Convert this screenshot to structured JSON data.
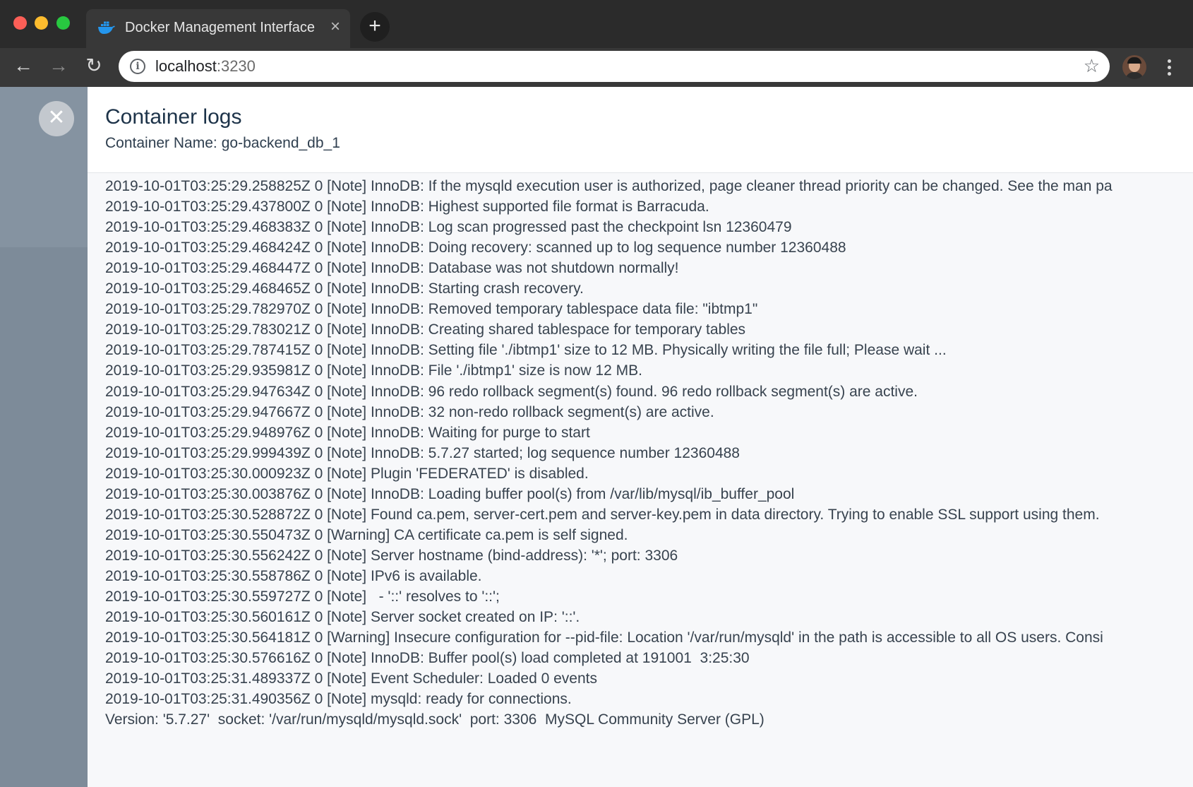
{
  "browser": {
    "tab_title": "Docker Management Interface",
    "url_host": "localhost",
    "url_port": ":3230"
  },
  "panel": {
    "title": "Container logs",
    "container_label": "Container Name:",
    "container_name": "go-backend_db_1"
  },
  "logs": [
    "2019-10-01T03:25:29.258825Z 0 [Note] InnoDB: If the mysqld execution user is authorized, page cleaner thread priority can be changed. See the man pa",
    "2019-10-01T03:25:29.437800Z 0 [Note] InnoDB: Highest supported file format is Barracuda.",
    "2019-10-01T03:25:29.468383Z 0 [Note] InnoDB: Log scan progressed past the checkpoint lsn 12360479",
    "2019-10-01T03:25:29.468424Z 0 [Note] InnoDB: Doing recovery: scanned up to log sequence number 12360488",
    "2019-10-01T03:25:29.468447Z 0 [Note] InnoDB: Database was not shutdown normally!",
    "2019-10-01T03:25:29.468465Z 0 [Note] InnoDB: Starting crash recovery.",
    "2019-10-01T03:25:29.782970Z 0 [Note] InnoDB: Removed temporary tablespace data file: \"ibtmp1\"",
    "2019-10-01T03:25:29.783021Z 0 [Note] InnoDB: Creating shared tablespace for temporary tables",
    "2019-10-01T03:25:29.787415Z 0 [Note] InnoDB: Setting file './ibtmp1' size to 12 MB. Physically writing the file full; Please wait ...",
    "2019-10-01T03:25:29.935981Z 0 [Note] InnoDB: File './ibtmp1' size is now 12 MB.",
    "2019-10-01T03:25:29.947634Z 0 [Note] InnoDB: 96 redo rollback segment(s) found. 96 redo rollback segment(s) are active.",
    "2019-10-01T03:25:29.947667Z 0 [Note] InnoDB: 32 non-redo rollback segment(s) are active.",
    "2019-10-01T03:25:29.948976Z 0 [Note] InnoDB: Waiting for purge to start",
    "2019-10-01T03:25:29.999439Z 0 [Note] InnoDB: 5.7.27 started; log sequence number 12360488",
    "2019-10-01T03:25:30.000923Z 0 [Note] Plugin 'FEDERATED' is disabled.",
    "2019-10-01T03:25:30.003876Z 0 [Note] InnoDB: Loading buffer pool(s) from /var/lib/mysql/ib_buffer_pool",
    "2019-10-01T03:25:30.528872Z 0 [Note] Found ca.pem, server-cert.pem and server-key.pem in data directory. Trying to enable SSL support using them.",
    "2019-10-01T03:25:30.550473Z 0 [Warning] CA certificate ca.pem is self signed.",
    "2019-10-01T03:25:30.556242Z 0 [Note] Server hostname (bind-address): '*'; port: 3306",
    "2019-10-01T03:25:30.558786Z 0 [Note] IPv6 is available.",
    "2019-10-01T03:25:30.559727Z 0 [Note]   - '::' resolves to '::';",
    "2019-10-01T03:25:30.560161Z 0 [Note] Server socket created on IP: '::'.",
    "2019-10-01T03:25:30.564181Z 0 [Warning] Insecure configuration for --pid-file: Location '/var/run/mysqld' in the path is accessible to all OS users. Consi",
    "2019-10-01T03:25:30.576616Z 0 [Note] InnoDB: Buffer pool(s) load completed at 191001  3:25:30",
    "2019-10-01T03:25:31.489337Z 0 [Note] Event Scheduler: Loaded 0 events",
    "2019-10-01T03:25:31.490356Z 0 [Note] mysqld: ready for connections.",
    "Version: '5.7.27'  socket: '/var/run/mysqld/mysqld.sock'  port: 3306  MySQL Community Server (GPL)"
  ],
  "icons": {
    "tab_favicon": "docker-whale-icon",
    "tab_close": "close-icon",
    "new_tab": "plus-icon",
    "back": "arrow-left-icon",
    "forward": "arrow-right-icon",
    "reload": "reload-icon",
    "site_info": "info-icon",
    "bookmark": "star-icon",
    "profile": "avatar",
    "menu": "more-vertical-icon",
    "panel_close": "close-icon"
  },
  "colors": {
    "chrome_bg": "#2b2b2b",
    "overlay": "#7d8b99",
    "panel_title": "#1d3349",
    "log_text": "#38434f",
    "log_bg": "#f7f8fa"
  }
}
